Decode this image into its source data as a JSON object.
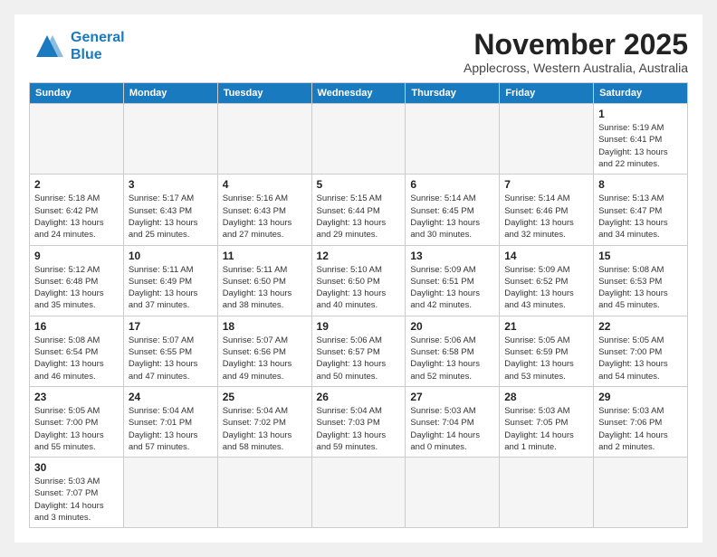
{
  "header": {
    "logo_general": "General",
    "logo_blue": "Blue",
    "month_title": "November 2025",
    "subtitle": "Applecross, Western Australia, Australia"
  },
  "weekdays": [
    "Sunday",
    "Monday",
    "Tuesday",
    "Wednesday",
    "Thursday",
    "Friday",
    "Saturday"
  ],
  "weeks": [
    [
      {
        "day": "",
        "info": ""
      },
      {
        "day": "",
        "info": ""
      },
      {
        "day": "",
        "info": ""
      },
      {
        "day": "",
        "info": ""
      },
      {
        "day": "",
        "info": ""
      },
      {
        "day": "",
        "info": ""
      },
      {
        "day": "1",
        "info": "Sunrise: 5:19 AM\nSunset: 6:41 PM\nDaylight: 13 hours\nand 22 minutes."
      }
    ],
    [
      {
        "day": "2",
        "info": "Sunrise: 5:18 AM\nSunset: 6:42 PM\nDaylight: 13 hours\nand 24 minutes."
      },
      {
        "day": "3",
        "info": "Sunrise: 5:17 AM\nSunset: 6:43 PM\nDaylight: 13 hours\nand 25 minutes."
      },
      {
        "day": "4",
        "info": "Sunrise: 5:16 AM\nSunset: 6:43 PM\nDaylight: 13 hours\nand 27 minutes."
      },
      {
        "day": "5",
        "info": "Sunrise: 5:15 AM\nSunset: 6:44 PM\nDaylight: 13 hours\nand 29 minutes."
      },
      {
        "day": "6",
        "info": "Sunrise: 5:14 AM\nSunset: 6:45 PM\nDaylight: 13 hours\nand 30 minutes."
      },
      {
        "day": "7",
        "info": "Sunrise: 5:14 AM\nSunset: 6:46 PM\nDaylight: 13 hours\nand 32 minutes."
      },
      {
        "day": "8",
        "info": "Sunrise: 5:13 AM\nSunset: 6:47 PM\nDaylight: 13 hours\nand 34 minutes."
      }
    ],
    [
      {
        "day": "9",
        "info": "Sunrise: 5:12 AM\nSunset: 6:48 PM\nDaylight: 13 hours\nand 35 minutes."
      },
      {
        "day": "10",
        "info": "Sunrise: 5:11 AM\nSunset: 6:49 PM\nDaylight: 13 hours\nand 37 minutes."
      },
      {
        "day": "11",
        "info": "Sunrise: 5:11 AM\nSunset: 6:50 PM\nDaylight: 13 hours\nand 38 minutes."
      },
      {
        "day": "12",
        "info": "Sunrise: 5:10 AM\nSunset: 6:50 PM\nDaylight: 13 hours\nand 40 minutes."
      },
      {
        "day": "13",
        "info": "Sunrise: 5:09 AM\nSunset: 6:51 PM\nDaylight: 13 hours\nand 42 minutes."
      },
      {
        "day": "14",
        "info": "Sunrise: 5:09 AM\nSunset: 6:52 PM\nDaylight: 13 hours\nand 43 minutes."
      },
      {
        "day": "15",
        "info": "Sunrise: 5:08 AM\nSunset: 6:53 PM\nDaylight: 13 hours\nand 45 minutes."
      }
    ],
    [
      {
        "day": "16",
        "info": "Sunrise: 5:08 AM\nSunset: 6:54 PM\nDaylight: 13 hours\nand 46 minutes."
      },
      {
        "day": "17",
        "info": "Sunrise: 5:07 AM\nSunset: 6:55 PM\nDaylight: 13 hours\nand 47 minutes."
      },
      {
        "day": "18",
        "info": "Sunrise: 5:07 AM\nSunset: 6:56 PM\nDaylight: 13 hours\nand 49 minutes."
      },
      {
        "day": "19",
        "info": "Sunrise: 5:06 AM\nSunset: 6:57 PM\nDaylight: 13 hours\nand 50 minutes."
      },
      {
        "day": "20",
        "info": "Sunrise: 5:06 AM\nSunset: 6:58 PM\nDaylight: 13 hours\nand 52 minutes."
      },
      {
        "day": "21",
        "info": "Sunrise: 5:05 AM\nSunset: 6:59 PM\nDaylight: 13 hours\nand 53 minutes."
      },
      {
        "day": "22",
        "info": "Sunrise: 5:05 AM\nSunset: 7:00 PM\nDaylight: 13 hours\nand 54 minutes."
      }
    ],
    [
      {
        "day": "23",
        "info": "Sunrise: 5:05 AM\nSunset: 7:00 PM\nDaylight: 13 hours\nand 55 minutes."
      },
      {
        "day": "24",
        "info": "Sunrise: 5:04 AM\nSunset: 7:01 PM\nDaylight: 13 hours\nand 57 minutes."
      },
      {
        "day": "25",
        "info": "Sunrise: 5:04 AM\nSunset: 7:02 PM\nDaylight: 13 hours\nand 58 minutes."
      },
      {
        "day": "26",
        "info": "Sunrise: 5:04 AM\nSunset: 7:03 PM\nDaylight: 13 hours\nand 59 minutes."
      },
      {
        "day": "27",
        "info": "Sunrise: 5:03 AM\nSunset: 7:04 PM\nDaylight: 14 hours\nand 0 minutes."
      },
      {
        "day": "28",
        "info": "Sunrise: 5:03 AM\nSunset: 7:05 PM\nDaylight: 14 hours\nand 1 minute."
      },
      {
        "day": "29",
        "info": "Sunrise: 5:03 AM\nSunset: 7:06 PM\nDaylight: 14 hours\nand 2 minutes."
      }
    ],
    [
      {
        "day": "30",
        "info": "Sunrise: 5:03 AM\nSunset: 7:07 PM\nDaylight: 14 hours\nand 3 minutes."
      },
      {
        "day": "",
        "info": ""
      },
      {
        "day": "",
        "info": ""
      },
      {
        "day": "",
        "info": ""
      },
      {
        "day": "",
        "info": ""
      },
      {
        "day": "",
        "info": ""
      },
      {
        "day": "",
        "info": ""
      }
    ]
  ]
}
